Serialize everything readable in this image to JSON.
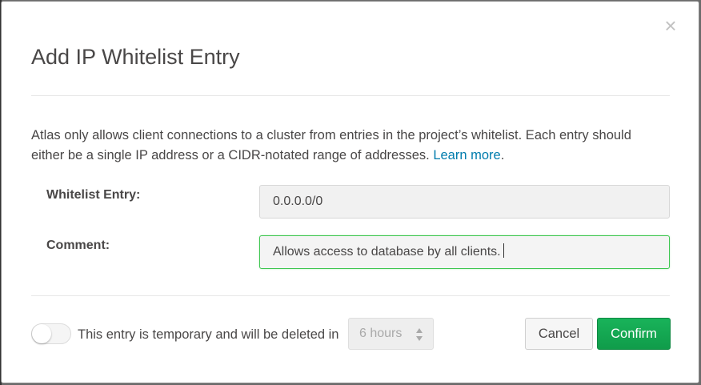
{
  "modal": {
    "title": "Add IP Whitelist Entry",
    "close_symbol": "×",
    "description": "Atlas only allows client connections to a cluster from entries in the project’s whitelist. Each entry should either be a single IP address or a CIDR-notated range of addresses. ",
    "learn_more": "Learn more",
    "description_end": "."
  },
  "form": {
    "whitelist_label": "Whitelist Entry:",
    "whitelist_value": "0.0.0.0/0",
    "comment_label": "Comment:",
    "comment_value": "Allows access to database by all clients."
  },
  "footer": {
    "temporary_text": "This entry is temporary and will be deleted in",
    "temporary_enabled": false,
    "duration_selected": "6 hours",
    "cancel_label": "Cancel",
    "confirm_label": "Confirm"
  },
  "colors": {
    "confirm": "#13aa52",
    "link": "#007cad",
    "focus_border": "#3ec650"
  }
}
